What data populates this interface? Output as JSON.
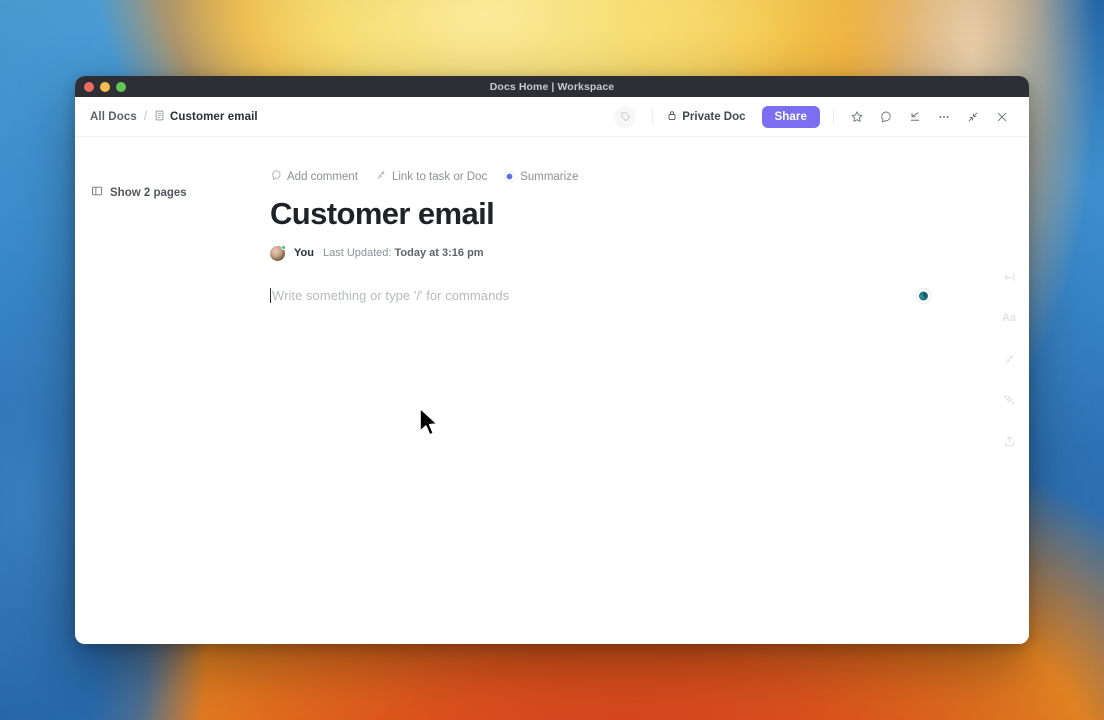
{
  "window": {
    "titlebar_title": "Docs Home | Workspace",
    "traffic_lights": [
      "close-red",
      "minimize-yellow",
      "zoom-green"
    ]
  },
  "header": {
    "breadcrumb": {
      "root": "All Docs",
      "separator": "/",
      "current": "Customer email",
      "doc_icon": "document-icon"
    },
    "tag_icon": "tag-icon",
    "privacy": {
      "label": "Private Doc",
      "icon": "lock-icon"
    },
    "share": {
      "label": "Share",
      "color": "#7b6ef0"
    },
    "actions": [
      {
        "name": "favorite-star-icon"
      },
      {
        "name": "search-icon"
      },
      {
        "name": "collapse-down-icon"
      },
      {
        "name": "more-options-icon"
      },
      {
        "name": "minimize-diagonal-icon"
      },
      {
        "name": "close-icon"
      }
    ]
  },
  "sidebar": {
    "show_pages_label": "Show 2 pages",
    "panel_icon": "panel-left-icon"
  },
  "doc": {
    "actions": [
      {
        "label": "Add comment",
        "icon": "comment-icon"
      },
      {
        "label": "Link to task or Doc",
        "icon": "link-wand-icon"
      },
      {
        "label": "Summarize",
        "icon": "ai-circle-icon"
      }
    ],
    "title": "Customer email",
    "meta": {
      "author": "You",
      "updated_prefix": "Last Updated:",
      "updated_value": "Today at 3:16 pm",
      "avatar": "user-avatar",
      "status": "online"
    },
    "editor": {
      "placeholder": "Write something or type '/' for commands",
      "value": "",
      "ai_orb": "ai-assistant-icon"
    }
  },
  "right_rail": [
    {
      "name": "collapse-panel-icon"
    },
    {
      "name": "font-size-icon",
      "glyph": "Aa"
    },
    {
      "name": "relationships-icon"
    },
    {
      "name": "ai-sparkle-icon"
    },
    {
      "name": "share-export-icon"
    }
  ],
  "colors": {
    "accent": "#7b6ef0",
    "titlebar": "#2e2e35",
    "text_primary": "#1f2328",
    "text_muted": "#8d9097",
    "online": "#3ec46d"
  }
}
